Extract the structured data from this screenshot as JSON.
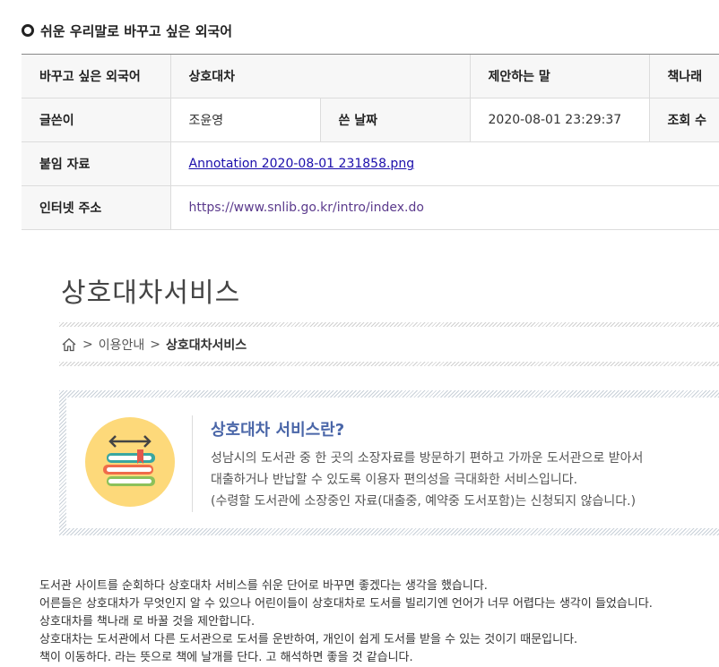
{
  "section": {
    "title": "쉬운 우리말로 바꾸고 싶은 외국어"
  },
  "meta": {
    "foreign_word_label": "바꾸고 싶은 외국어",
    "foreign_word_value": "상호대차",
    "suggestion_label": "제안하는 말",
    "suggestion_value": "책나래",
    "author_label": "글쓴이",
    "author_value": "조윤영",
    "date_label": "쓴 날짜",
    "date_value": "2020-08-01 23:29:37",
    "views_label": "조회 수",
    "attachment_label": "붙임 자료",
    "attachment_value": "Annotation 2020-08-01 231858.png",
    "url_label": "인터넷 주소",
    "url_value": "https://www.snlib.go.kr/intro/index.do"
  },
  "embedded_page": {
    "heading": "상호대차서비스",
    "breadcrumb": [
      "이용안내",
      "상호대차서비스"
    ],
    "breadcrumb_sep": ">",
    "service_title": "상호대차 서비스란?",
    "service_lines": [
      "성남시의 도서관 중 한 곳의 소장자료를 방문하기 편하고 가까운 도서관으로 받아서",
      "대출하거나 반납할 수 있도록 이용자 편의성을 극대화한 서비스입니다.",
      "(수령할 도서관에 소장중인 자료(대출중, 예약중 도서포함)는 신청되지 않습니다.)"
    ]
  },
  "body_lines": [
    "도서관 사이트를 순회하다 상호대차 서비스를 쉬운 단어로 바꾸면 좋겠다는 생각을 했습니다.",
    "어른들은 상호대차가 무엇인지 알 수 있으나 어린이들이 상호대차로 도서를 빌리기엔 언어가 너무 어렵다는 생각이 들었습니다.",
    "상호대차를 책나래 로 바꿀 것을 제안합니다.",
    "상호대차는 도서관에서 다른 도서관으로 도서를 운반하여, 개인이 쉽게 도서를 받을 수 있는 것이기 때문입니다.",
    "책이 이동하다. 라는 뜻으로 책에 날개를 단다. 고 해석하면 좋을 것 같습니다."
  ],
  "colors": {
    "accent_blue": "#4a66a8",
    "circle_yellow": "#fdd97a",
    "link": "#1a0dab",
    "visited": "#5b3a8c"
  },
  "icons": {
    "bullet": "circle-bullet-icon",
    "home": "home-icon",
    "books": "books-icon"
  }
}
